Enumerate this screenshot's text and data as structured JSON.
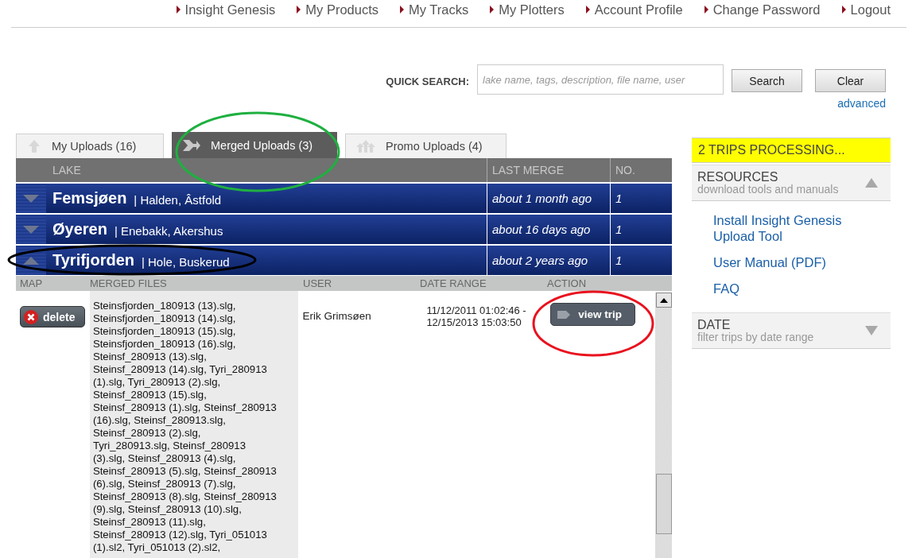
{
  "nav": [
    "Insight Genesis",
    "My Products",
    "My Tracks",
    "My Plotters",
    "Account Profile",
    "Change Password",
    "Logout"
  ],
  "search": {
    "label": "QUICK SEARCH:",
    "placeholder": "lake name, tags, description, file name, user",
    "buttons": [
      "Search",
      "Clear"
    ],
    "advanced": "advanced"
  },
  "tabs": [
    {
      "label": "My Uploads (16)",
      "selected": false,
      "kind": "single"
    },
    {
      "label": "Merged Uploads (3)",
      "selected": true,
      "kind": "merge"
    },
    {
      "label": "Promo Uploads (4)",
      "selected": false,
      "kind": "multi"
    }
  ],
  "table": {
    "columns": [
      "LAKE",
      "LAST MERGE",
      "NO."
    ],
    "rows": [
      {
        "lake": "Femsjøen",
        "place": "| Halden, Âstfold",
        "last_merge": "about 1 month ago",
        "no": "1",
        "expanded": false
      },
      {
        "lake": "Øyeren",
        "place": "| Enebakk, Akershus",
        "last_merge": "about 16 days ago",
        "no": "1",
        "expanded": false
      },
      {
        "lake": "Tyrifjorden",
        "place": "| Hole, Buskerud",
        "last_merge": "about 2 years ago",
        "no": "1",
        "expanded": true
      }
    ]
  },
  "detail": {
    "columns": [
      "MAP",
      "MERGED FILES",
      "USER",
      "DATE RANGE",
      "ACTION"
    ],
    "delete": "delete",
    "files": [
      "Steinsfjorden_180913 (13).slg,",
      "Steinsfjorden_180913 (14).slg,",
      "Steinsfjorden_180913 (15).slg,",
      "Steinsfjorden_180913 (16).slg,",
      "Steinsf_280913 (13).slg,",
      "Steinsf_280913 (14).slg, Tyri_280913",
      "(1).slg, Tyri_280913 (2).slg,",
      "Steinsf_280913 (15).slg,",
      "Steinsf_280913 (1).slg, Steinsf_280913",
      "(16).slg, Steinsf_280913.slg,",
      "Steinsf_280913 (2).slg,",
      "Tyri_280913.slg, Steinsf_280913",
      "(3).slg, Steinsf_280913 (4).slg,",
      "Steinsf_280913 (5).slg, Steinsf_280913",
      "(6).slg, Steinsf_280913 (7).slg,",
      "Steinsf_280913 (8).slg, Steinsf_280913",
      "(9).slg, Steinsf_280913 (10).slg,",
      "Steinsf_280913 (11).slg,",
      "Steinsf_280913 (12).slg, Tyri_051013",
      "(1).sl2, Tyri_051013 (2).sl2,"
    ],
    "user": "Erik Grimsøen",
    "date_from": "11/12/2011 01:02:46 -",
    "date_to": "12/15/2013 15:03:50",
    "action": "view trip"
  },
  "sidebar": {
    "status": "2 TRIPS PROCESSING...",
    "sections": [
      {
        "title": "RESOURCES",
        "subtitle": "download tools and manuals",
        "expanded": true,
        "links": [
          "Install Insight Genesis Upload Tool",
          "User Manual (PDF)",
          "FAQ"
        ]
      },
      {
        "title": "DATE",
        "subtitle": "filter trips by date range",
        "expanded": false
      }
    ]
  }
}
